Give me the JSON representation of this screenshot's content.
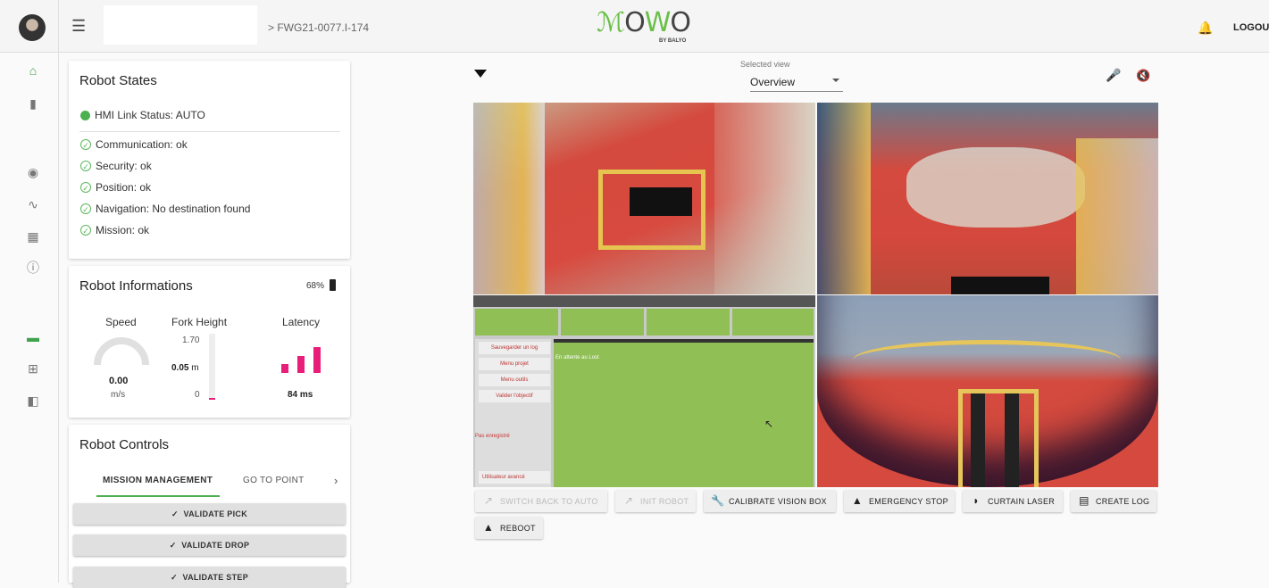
{
  "header": {
    "breadcrumb": "> FWG21-0077.I-174",
    "logo_main": "MOWO",
    "logo_sub": "BY BALYO",
    "logout": "LOGOUT"
  },
  "sidebar": {
    "icons": [
      "home-icon",
      "clipboard-icon",
      "eye-icon",
      "trend-icon",
      "bar-chart-icon",
      "info-icon",
      "video-icon",
      "add-box-icon",
      "library-icon"
    ]
  },
  "robot_states": {
    "title": "Robot States",
    "hmi_status": "HMI Link Status: AUTO",
    "items": [
      "Communication: ok",
      "Security: ok",
      "Position: ok",
      "Navigation: No destination found",
      "Mission: ok"
    ]
  },
  "robot_info": {
    "title": "Robot Informations",
    "battery": "68%",
    "speed_label": "Speed",
    "speed_value": "0.00",
    "speed_unit": "m/s",
    "fork_label": "Fork Height",
    "fork_max": "1.70",
    "fork_value": "0.05",
    "fork_unit": "m",
    "fork_min": "0",
    "latency_label": "Latency",
    "latency_value": "84 ms"
  },
  "robot_controls": {
    "title": "Robot Controls",
    "tabs": [
      "MISSION MANAGEMENT",
      "GO TO POINT"
    ],
    "buttons": [
      "VALIDATE PICK",
      "VALIDATE DROP",
      "VALIDATE STEP"
    ]
  },
  "view": {
    "selected_label": "Selected view",
    "selected_value": "Overview"
  },
  "hmi_screen": {
    "menu": [
      "Sauvegarder un log",
      "Menu projet",
      "Menu outils",
      "Valider l'objectif"
    ],
    "message": "En attente au Lost",
    "status": "Pas enregistré",
    "user": "Utilisateur avancé"
  },
  "actions": {
    "switch_auto": "SWITCH BACK TO AUTO",
    "init_robot": "INIT ROBOT",
    "calibrate": "CALIBRATE VISION BOX",
    "emergency": "EMERGENCY STOP",
    "curtain": "CURTAIN LASER",
    "create_log": "CREATE LOG",
    "reboot": "REBOOT"
  },
  "colors": {
    "accent_green": "#4caf50",
    "latency_pink": "#e91e7a",
    "hmi_green": "#8fbf55"
  }
}
